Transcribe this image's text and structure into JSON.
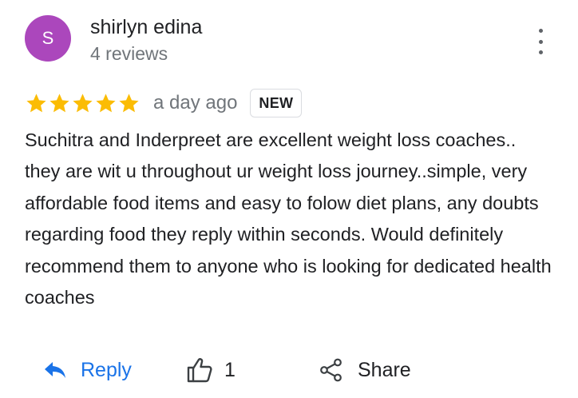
{
  "review": {
    "author": {
      "initial": "S",
      "name": "shirlyn edina",
      "meta": "4 reviews",
      "avatar_color": "#ab47bc"
    },
    "rating": 5,
    "date": "a day ago",
    "badge": "NEW",
    "text": "Suchitra and Inderpreet are excellent weight loss coaches.. they are wit u throughout ur weight loss journey..simple, very affordable food items and easy to folow diet plans, any doubts regarding food they reply within seconds. Would definitely recommend them to anyone who is looking for dedicated health coaches",
    "star_color": "#fbbc04"
  },
  "actions": {
    "reply_label": "Reply",
    "like_count": "1",
    "share_label": "Share",
    "reply_color": "#1a73e8",
    "icons": {
      "reply": "reply-arrow-icon",
      "like": "thumbs-up-icon",
      "share": "share-icon",
      "more": "more-vertical-icon"
    }
  }
}
